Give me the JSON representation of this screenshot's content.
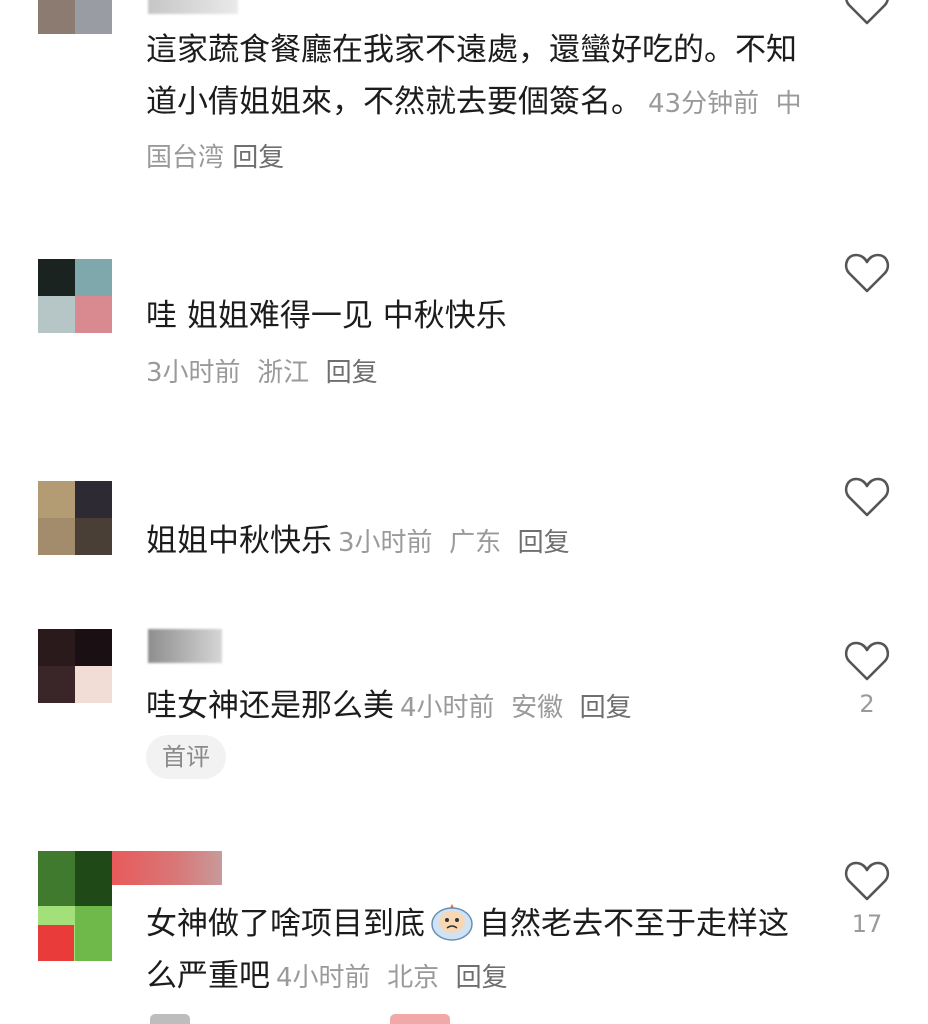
{
  "comments": [
    {
      "text": "這家蔬食餐廳在我家不遠處，還蠻好吃的。不知道小倩姐姐來，不然就去要個簽名。",
      "time": "43分钟前",
      "location": "中国台湾",
      "reply": "回复",
      "likes": ""
    },
    {
      "text": "哇 姐姐难得一见 中秋快乐",
      "time": "3小时前",
      "location": "浙江",
      "reply": "回复",
      "likes": ""
    },
    {
      "text": "姐姐中秋快乐",
      "time": "3小时前",
      "location": "广东",
      "reply": "回复",
      "likes": ""
    },
    {
      "text": "哇女神还是那么美",
      "time": "4小时前",
      "location": "安徽",
      "reply": "回复",
      "likes": "2",
      "tag": "首评"
    },
    {
      "text_part1": "女神做了啥项目到底",
      "emoji": "crying-face-emoji",
      "text_part2": "自然老去不至于走样这么严重吧",
      "time": "4小时前",
      "location": "北京",
      "reply": "回复",
      "likes": "17"
    }
  ],
  "icons": {
    "like": "heart-outline-icon"
  },
  "colors": {
    "text": "#1c1c1c",
    "meta": "#9a9a9a",
    "tag_bg": "#f2f2f2"
  }
}
